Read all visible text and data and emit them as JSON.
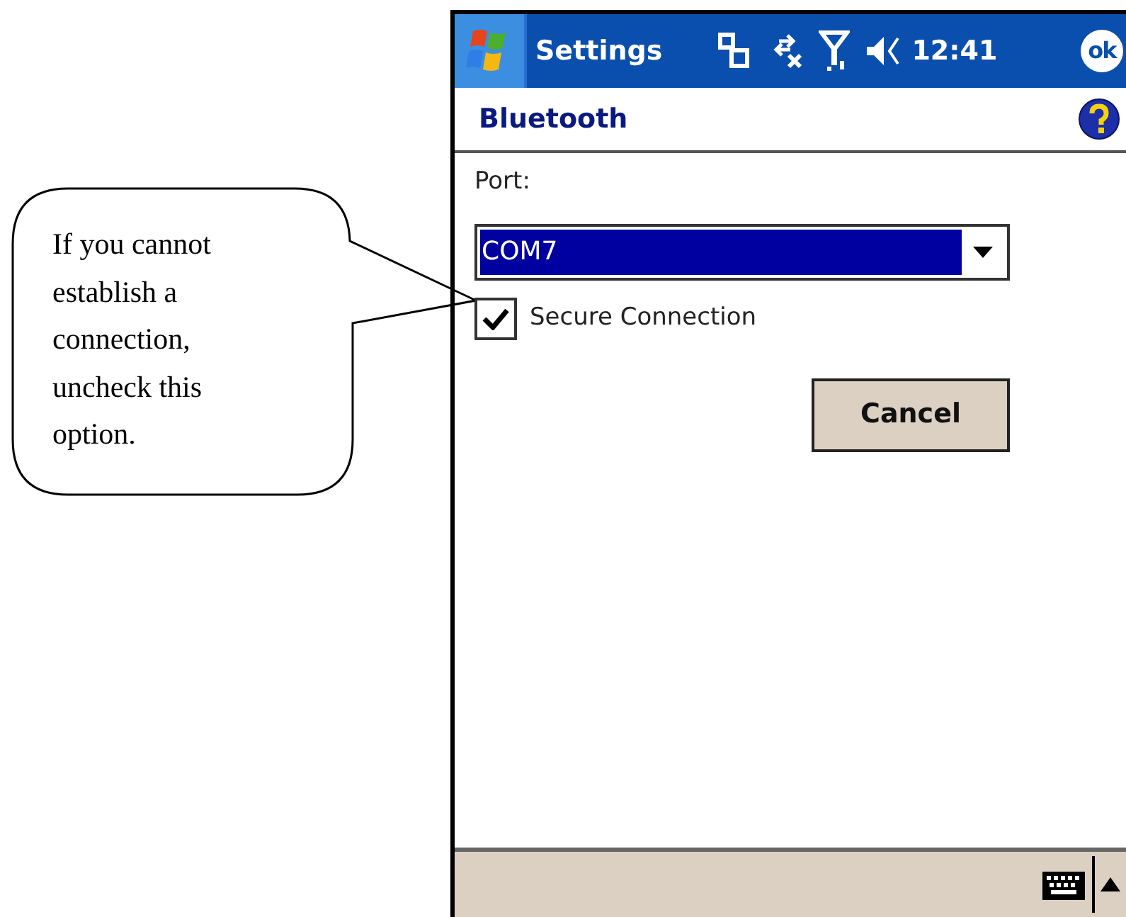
{
  "callout": {
    "text": "If you cannot establish a connection, uncheck this option."
  },
  "title_bar": {
    "title": "Settings",
    "time": "12:41",
    "ok": "ok"
  },
  "header": {
    "title": "Bluetooth"
  },
  "form": {
    "port_label": "Port:",
    "port": {
      "value": "COM7",
      "selected": true
    },
    "secure": {
      "label": "Secure Connection",
      "checked": true
    },
    "cancel": "Cancel"
  }
}
